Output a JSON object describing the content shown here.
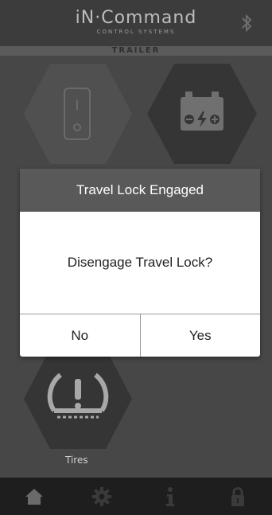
{
  "header": {
    "brand": "iN·Command",
    "brand_sub": "CONTROL SYSTEMS",
    "bluetooth_icon": "bluetooth-icon"
  },
  "subtitle": "TRAILER",
  "tiles": [
    {
      "name": "switch",
      "icon": "toggle-switch-icon"
    },
    {
      "name": "battery",
      "icon": "battery-icon"
    },
    {
      "name": "tires",
      "icon": "tire-pressure-icon",
      "label": "Tires"
    }
  ],
  "dialog": {
    "title": "Travel Lock Engaged",
    "message": "Disengage Travel Lock?",
    "no_label": "No",
    "yes_label": "Yes"
  },
  "nav": [
    {
      "icon": "home-icon",
      "active": true
    },
    {
      "icon": "gear-icon",
      "active": false
    },
    {
      "icon": "info-icon",
      "active": false
    },
    {
      "icon": "lock-icon",
      "active": false
    }
  ],
  "colors": {
    "background": "#474747",
    "header": "#3c3c3c",
    "dialog_title": "#595959",
    "nav": "#1e1e1e"
  }
}
